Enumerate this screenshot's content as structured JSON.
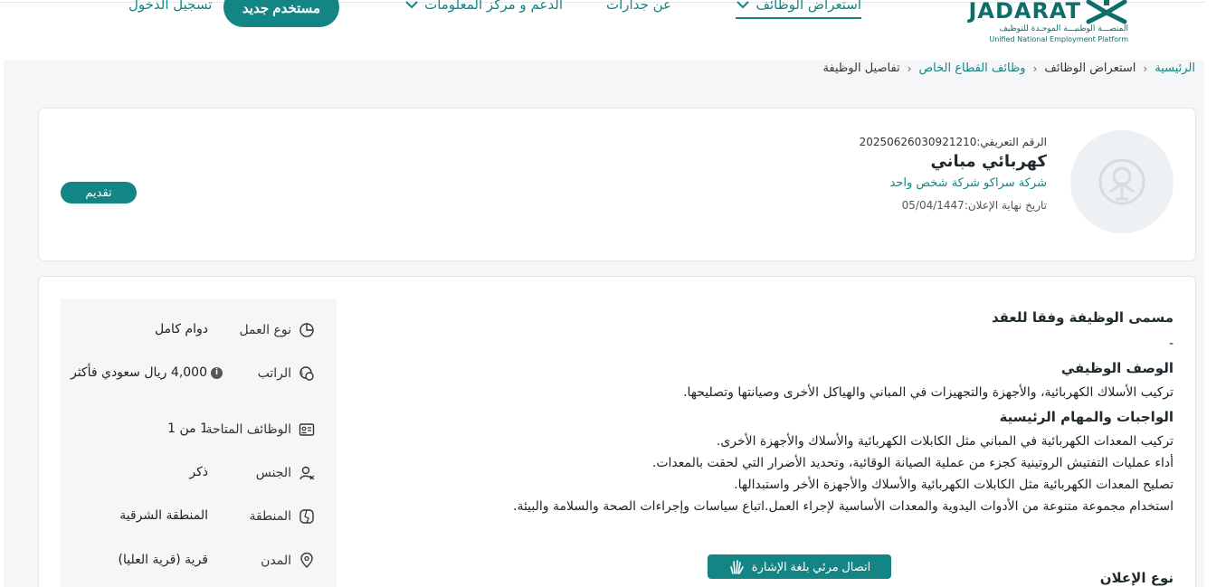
{
  "header": {
    "logo_word": "JADARAT",
    "logo_ar": "المنصـــة الوطنيـــة الموحـدة للتوظيف",
    "logo_en": "Unified National Employment Platform",
    "nav": [
      {
        "label": "استعراض الوظائف",
        "active": true,
        "has_dropdown": true
      },
      {
        "label": "عن جدارات",
        "active": false,
        "has_dropdown": false
      },
      {
        "label": "الدعم و مركز المعلومات",
        "active": false,
        "has_dropdown": true
      }
    ],
    "new_user_label": "مستخدم جديد",
    "login_label": "تسجيل الدخول"
  },
  "breadcrumb": [
    {
      "label": "الرئيسية",
      "link": true
    },
    {
      "label": "استعراض الوظائف",
      "link": false
    },
    {
      "label": "وظائف القطاع الخاص",
      "link": true
    },
    {
      "label": "تفاصيل الوظيفة",
      "link": false
    }
  ],
  "job": {
    "id_text": "الرقم التعريفي:20250626030921210",
    "title": "كهربائي مباني",
    "company": "شركة سراكو شركة شخص واحد",
    "deadline_text": "تاريخ نهاية الإعلان:05/04/1447",
    "apply_label": "تقديم"
  },
  "details": [
    {
      "icon": "pie-chart-icon",
      "label": "نوع العمل",
      "value": "دوام كامل"
    },
    {
      "icon": "money-icon",
      "label": "الراتب",
      "value": "4,000 ريال سعودي فأكثر",
      "info": true
    },
    {
      "icon": "id-card-icon",
      "label": "الوظائف المتاحة",
      "value": "1 من 1"
    },
    {
      "icon": "user-icon",
      "label": "الجنس",
      "value": "ذكر"
    },
    {
      "icon": "map-region-icon",
      "label": "المنطقة",
      "value": "المنطقة الشرقية"
    },
    {
      "icon": "location-pin-icon",
      "label": "المدن",
      "value": "قرية (قرية العليا)"
    }
  ],
  "description": {
    "contract_title_heading": "مسمى الوظيفة وفقا للعقد",
    "contract_title_value": "-",
    "job_desc_heading": "الوصف الوظيفي",
    "job_desc_text": "تركيب الأسلاك الكهربائية، والأجهزة والتجهيزات في المباني والهياكل الأخرى وصيانتها وتصليحها.",
    "duties_heading": "الواجبات والمهام الرئيسية",
    "duties": [
      "تركيب المعدات الكهربائية في المباني مثل الكابلات الكهربائية والأسلاك والأجهزة الأخرى.",
      "أداء عمليات التفتيش الروتينية كجزء من عملية الصيانة الوقائية، وتحديد الأضرار التي لحقت بالمعدات.",
      "تصليح المعدات الكهربائية مثل الكابلات الكهربائية والأسلاك والأجهزة الأخر واستبدالها.",
      "استخدام مجموعة متنوعة من الأدوات اليدوية والمعدات الأساسية لإجراء العمل.اتباع سياسات وإجراءات الصحة والسلامة والبيئة."
    ],
    "sign_language_label": "اتصال مرئي بلغة الإشارة",
    "ad_type_heading": "نوع الإعلان"
  },
  "colors": {
    "primary": "#138584",
    "background": "#f4f6f7"
  }
}
